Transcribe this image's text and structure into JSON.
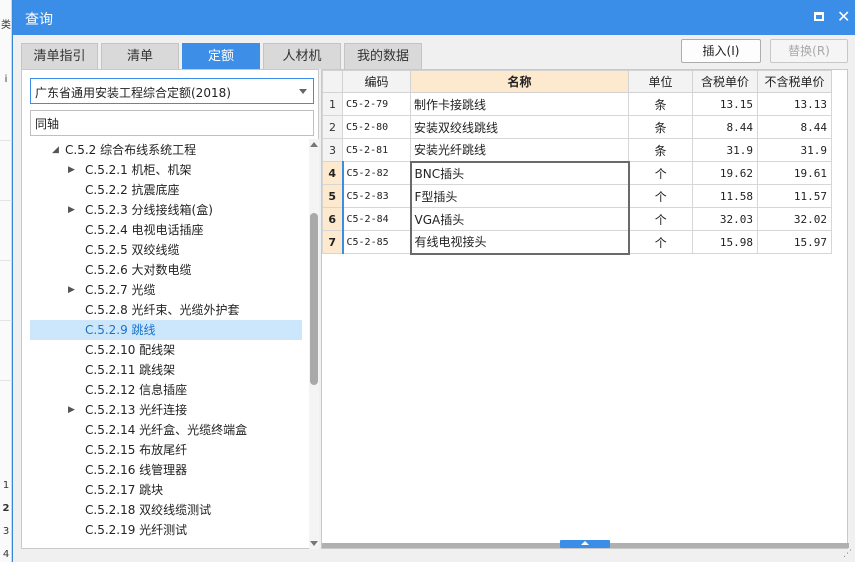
{
  "background_app": {
    "fragments": [
      "类",
      "i",
      "1",
      "2",
      "3",
      "4"
    ]
  },
  "dialog": {
    "title": "查询",
    "maximize_icon": "maximize-icon",
    "close_icon": "close-icon"
  },
  "tabs": [
    {
      "label": "清单指引",
      "active": false
    },
    {
      "label": "清单",
      "active": false
    },
    {
      "label": "定额",
      "active": true
    },
    {
      "label": "人材机",
      "active": false
    },
    {
      "label": "我的数据",
      "active": false
    }
  ],
  "toolbar": {
    "insert_label": "插入(I)",
    "replace_label": "替换(R)"
  },
  "left_panel": {
    "library_selected": "广东省通用安装工程综合定额(2018)",
    "search_value": "同轴",
    "tree": [
      {
        "label": "C.5.2 综合布线系统工程",
        "level": 0,
        "expander": "expanded"
      },
      {
        "label": "C.5.2.1 机柜、机架",
        "level": 1,
        "expander": "collapsed"
      },
      {
        "label": "C.5.2.2 抗震底座",
        "level": 1,
        "expander": "none"
      },
      {
        "label": "C.5.2.3 分线接线箱(盒)",
        "level": 1,
        "expander": "collapsed"
      },
      {
        "label": "C.5.2.4 电视电话插座",
        "level": 1,
        "expander": "none"
      },
      {
        "label": "C.5.2.5 双绞线缆",
        "level": 1,
        "expander": "none"
      },
      {
        "label": "C.5.2.6 大对数电缆",
        "level": 1,
        "expander": "none"
      },
      {
        "label": "C.5.2.7 光缆",
        "level": 1,
        "expander": "collapsed"
      },
      {
        "label": "C.5.2.8 光纤束、光缆外护套",
        "level": 1,
        "expander": "none"
      },
      {
        "label": "C.5.2.9 跳线",
        "level": 1,
        "expander": "none",
        "selected": true
      },
      {
        "label": "C.5.2.10 配线架",
        "level": 1,
        "expander": "none"
      },
      {
        "label": "C.5.2.11 跳线架",
        "level": 1,
        "expander": "none"
      },
      {
        "label": "C.5.2.12 信息插座",
        "level": 1,
        "expander": "none"
      },
      {
        "label": "C.5.2.13 光纤连接",
        "level": 1,
        "expander": "collapsed"
      },
      {
        "label": "C.5.2.14 光纤盒、光缆终端盒",
        "level": 1,
        "expander": "none"
      },
      {
        "label": "C.5.2.15 布放尾纤",
        "level": 1,
        "expander": "none"
      },
      {
        "label": "C.5.2.16 线管理器",
        "level": 1,
        "expander": "none"
      },
      {
        "label": "C.5.2.17 跳块",
        "level": 1,
        "expander": "none"
      },
      {
        "label": "C.5.2.18 双绞线缆测试",
        "level": 1,
        "expander": "none"
      },
      {
        "label": "C.5.2.19 光纤测试",
        "level": 1,
        "expander": "none"
      }
    ]
  },
  "grid": {
    "columns": [
      "",
      "编码",
      "名称",
      "单位",
      "含税单价",
      "不含税单价"
    ],
    "rows": [
      {
        "no": "1",
        "code": "C5-2-79",
        "name": "制作卡接跳线",
        "unit": "条",
        "tax_price": "13.15",
        "notax_price": "13.13"
      },
      {
        "no": "2",
        "code": "C5-2-80",
        "name": "安装双绞线跳线",
        "unit": "条",
        "tax_price": "8.44",
        "notax_price": "8.44"
      },
      {
        "no": "3",
        "code": "C5-2-81",
        "name": "安装光纤跳线",
        "unit": "条",
        "tax_price": "31.9",
        "notax_price": "31.9"
      },
      {
        "no": "4",
        "code": "C5-2-82",
        "name": "BNC插头",
        "unit": "个",
        "tax_price": "19.62",
        "notax_price": "19.61"
      },
      {
        "no": "5",
        "code": "C5-2-83",
        "name": "F型插头",
        "unit": "个",
        "tax_price": "11.58",
        "notax_price": "11.57"
      },
      {
        "no": "6",
        "code": "C5-2-84",
        "name": "VGA插头",
        "unit": "个",
        "tax_price": "32.03",
        "notax_price": "32.02"
      },
      {
        "no": "7",
        "code": "C5-2-85",
        "name": "有线电视接头",
        "unit": "个",
        "tax_price": "15.98",
        "notax_price": "15.97"
      }
    ]
  }
}
